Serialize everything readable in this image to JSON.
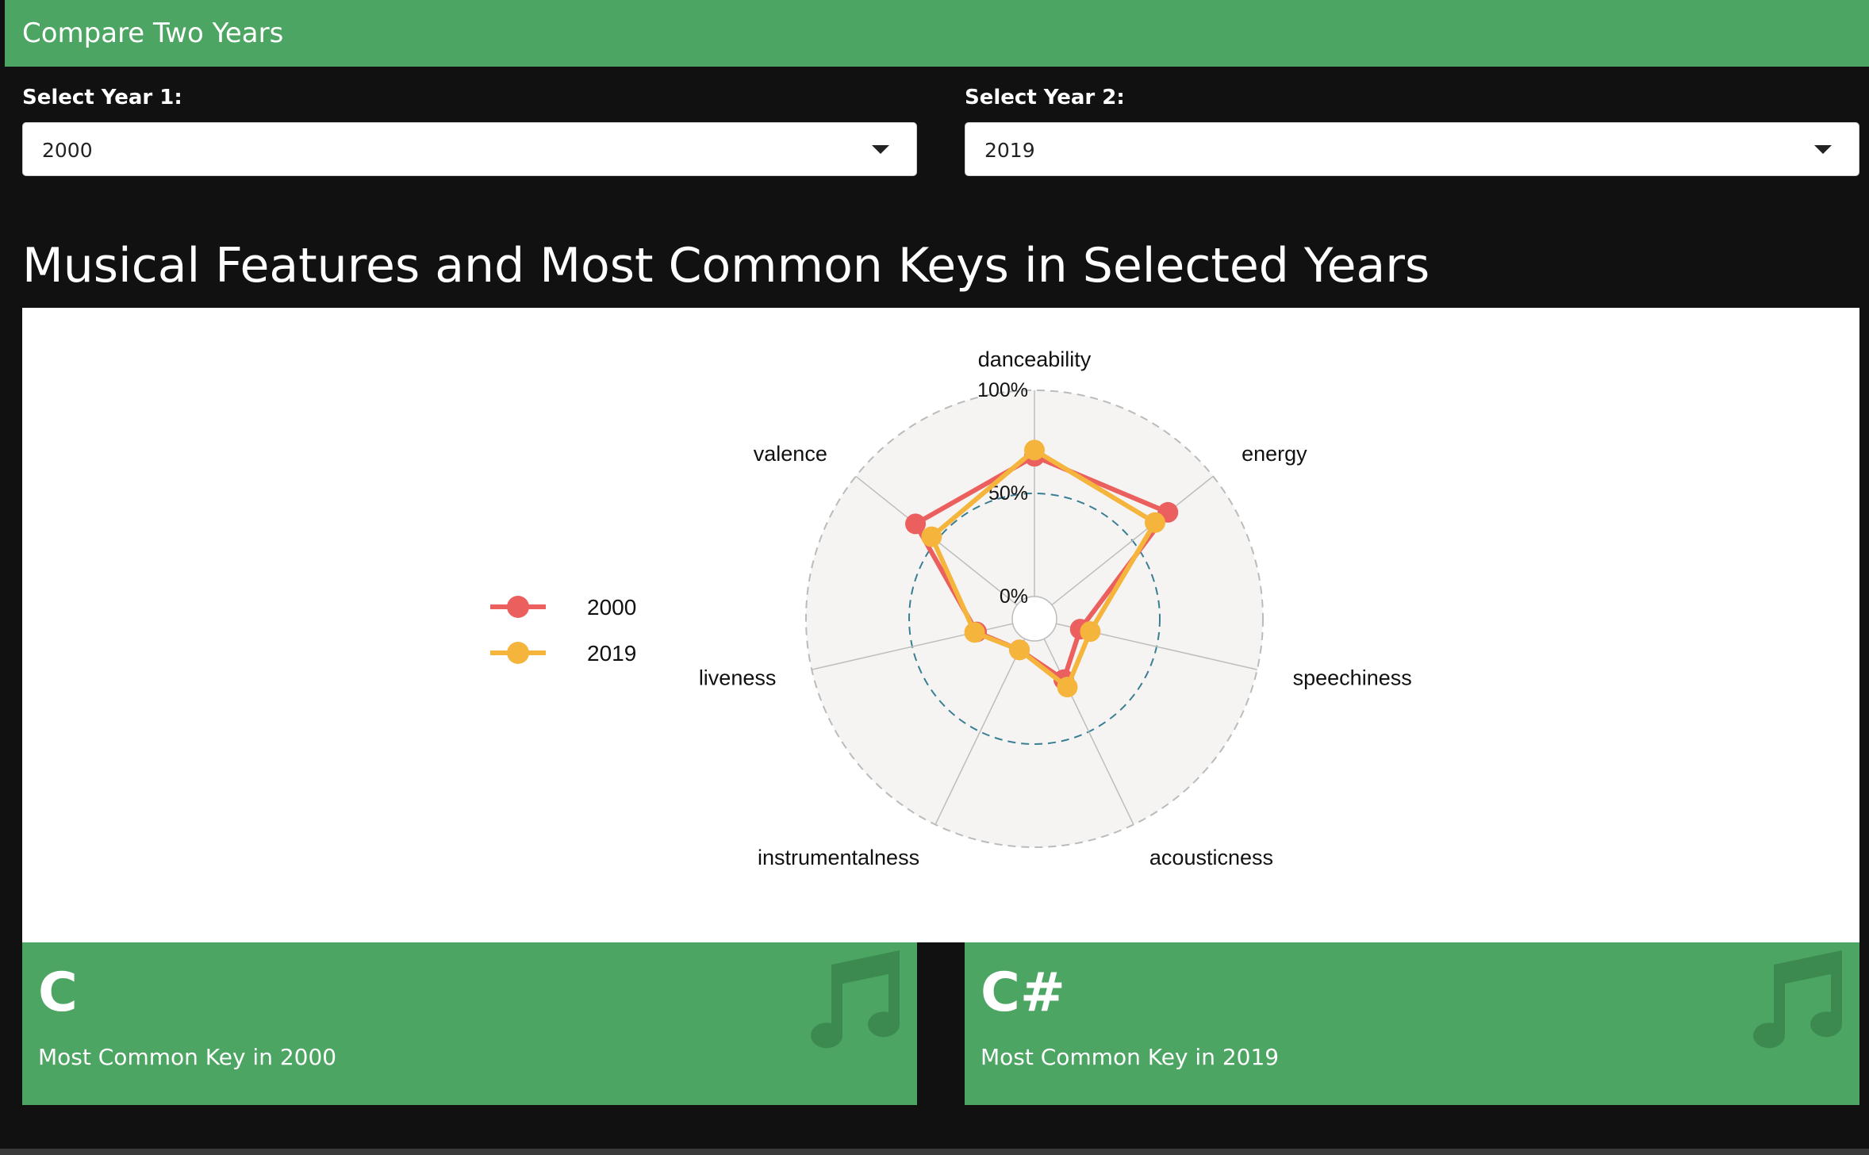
{
  "header": {
    "title": "Compare Two Years"
  },
  "year1": {
    "label": "Select Year 1:",
    "value": "2000"
  },
  "year2": {
    "label": "Select Year 2:",
    "value": "2019"
  },
  "section_title": "Musical Features and Most Common Keys in Selected Years",
  "chart_data": {
    "type": "radar",
    "axes": [
      "danceability",
      "energy",
      "speechiness",
      "acousticness",
      "instrumentalness",
      "liveness",
      "valence"
    ],
    "radial_ticks": [
      "0%",
      "50%",
      "100%"
    ],
    "rlim": [
      0,
      100
    ],
    "series": [
      {
        "name": "2000",
        "color": "#eb5f5f",
        "values": [
          68,
          72,
          12,
          22,
          6,
          18,
          63
        ]
      },
      {
        "name": "2019",
        "color": "#f5b53c",
        "values": [
          71,
          64,
          17,
          26,
          6,
          19,
          53
        ]
      }
    ],
    "legend": "left",
    "background": "#f5f4f2"
  },
  "key_boxes": [
    {
      "key": "C",
      "caption": "Most Common Key in 2000",
      "icon": "music-note-icon"
    },
    {
      "key": "C#",
      "caption": "Most Common Key in 2019",
      "icon": "music-note-icon"
    }
  ],
  "colors": {
    "accent": "#4ca562",
    "background": "#111111"
  }
}
